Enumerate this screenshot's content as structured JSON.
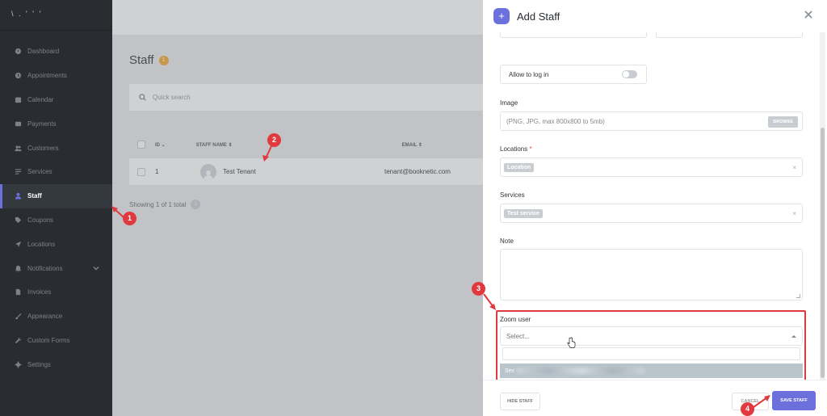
{
  "sidebar": {
    "logo": "\\ . ' ' ' ",
    "items": [
      {
        "label": "Dashboard",
        "icon": "dashboard-icon"
      },
      {
        "label": "Appointments",
        "icon": "clock-icon"
      },
      {
        "label": "Calendar",
        "icon": "calendar-icon"
      },
      {
        "label": "Payments",
        "icon": "wallet-icon"
      },
      {
        "label": "Customers",
        "icon": "users-icon"
      },
      {
        "label": "Services",
        "icon": "list-icon"
      },
      {
        "label": "Staff",
        "icon": "user-icon",
        "active": true
      },
      {
        "label": "Coupons",
        "icon": "tag-icon"
      },
      {
        "label": "Locations",
        "icon": "location-arrow-icon"
      },
      {
        "label": "Notifications",
        "icon": "bell-icon",
        "expandable": true
      },
      {
        "label": "Invoices",
        "icon": "file-icon"
      },
      {
        "label": "Appearance",
        "icon": "brush-icon"
      },
      {
        "label": "Custom Forms",
        "icon": "wrench-icon"
      },
      {
        "label": "Settings",
        "icon": "gear-icon"
      }
    ]
  },
  "main": {
    "title": "Staff",
    "count": "1",
    "search_placeholder": "Quick search",
    "columns": {
      "id": "ID",
      "name": "STAFF NAME",
      "email": "EMAIL"
    },
    "rows": [
      {
        "id": "1",
        "name": "Test Tenant",
        "email": "tenant@booknetic.com"
      }
    ],
    "showing": "Showing 1 of 1 total",
    "page": "1"
  },
  "panel": {
    "title": "Add Staff",
    "allow_login_label": "Allow to log in",
    "image_label": "Image",
    "image_hint": "(PNG, JPG, max 800x800 to 5mb)",
    "browse_label": "BROWSE",
    "locations_label": "Locations",
    "required_mark": "*",
    "location_tag": "Location",
    "services_label": "Services",
    "service_tag": "Test service",
    "note_label": "Note",
    "zoom_label": "Zoom user",
    "zoom_placeholder": "Select...",
    "zoom_option_prefix": "Sex",
    "hide_staff_label": "HIDE STAFF",
    "cancel_label": "CANCEL",
    "save_label": "SAVE STAFF"
  },
  "callouts": [
    "1",
    "2",
    "3",
    "4"
  ],
  "colors": {
    "accent": "#6c70dc",
    "callout": "#e0393e",
    "sidebar": "#292d32",
    "badge": "#f1a82b"
  }
}
